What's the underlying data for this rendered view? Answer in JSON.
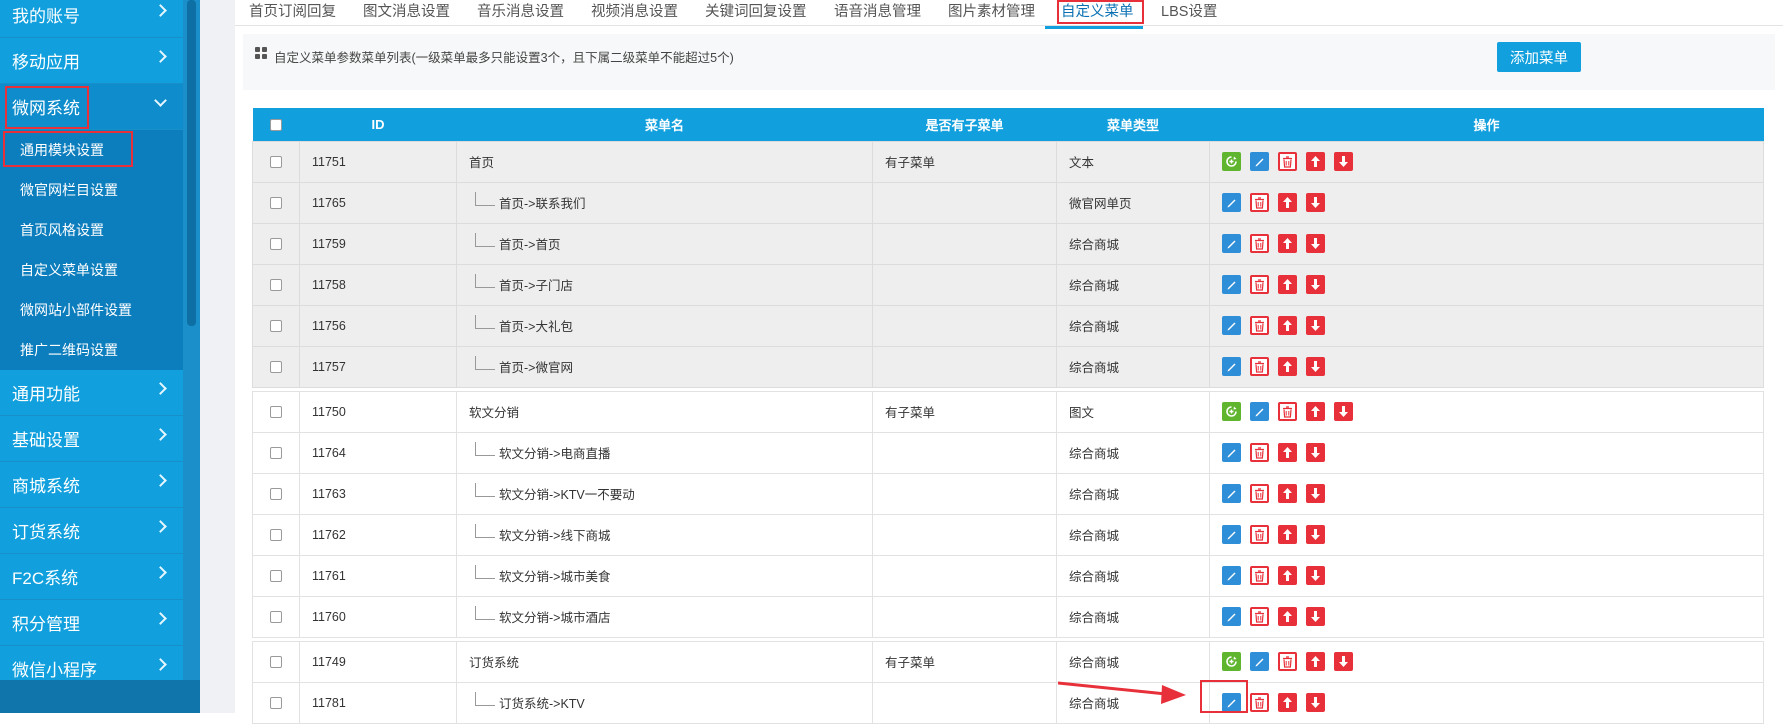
{
  "sidebar": {
    "menu": [
      {
        "label": "我的账号"
      },
      {
        "label": "移动应用"
      },
      {
        "label": "微网系统"
      },
      {
        "label": "通用功能"
      },
      {
        "label": "基础设置"
      },
      {
        "label": "商城系统"
      },
      {
        "label": "订货系统"
      },
      {
        "label": "F2C系统"
      },
      {
        "label": "积分管理"
      },
      {
        "label": "微信小程序"
      }
    ],
    "submenu": [
      {
        "label": "通用模块设置"
      },
      {
        "label": "微官网栏目设置"
      },
      {
        "label": "首页风格设置"
      },
      {
        "label": "自定义菜单设置"
      },
      {
        "label": "微网站小部件设置"
      },
      {
        "label": "推广二维码设置"
      }
    ]
  },
  "tabs": [
    {
      "label": "首页订阅回复"
    },
    {
      "label": "图文消息设置"
    },
    {
      "label": "音乐消息设置"
    },
    {
      "label": "视频消息设置"
    },
    {
      "label": "关键词回复设置"
    },
    {
      "label": "语音消息管理"
    },
    {
      "label": "图片素材管理"
    },
    {
      "label": "自定义菜单"
    },
    {
      "label": "LBS设置"
    }
  ],
  "info_text": "自定义菜单参数菜单列表(一级菜单最多只能设置3个，且下属二级菜单不能超过5个)",
  "add_button": "添加菜单",
  "table": {
    "headers": {
      "id": "ID",
      "name": "菜单名",
      "has_sub": "是否有子菜单",
      "type": "菜单类型",
      "ops": "操作"
    },
    "rows": [
      {
        "id": "11751",
        "name": "首页",
        "has_sub": "有子菜单",
        "type": "文本",
        "level": 1,
        "group": 1
      },
      {
        "id": "11765",
        "name": "首页->联系我们",
        "has_sub": "",
        "type": "微官网单页",
        "level": 2,
        "group": 1
      },
      {
        "id": "11759",
        "name": "首页->首页",
        "has_sub": "",
        "type": "综合商城",
        "level": 2,
        "group": 1
      },
      {
        "id": "11758",
        "name": "首页->子门店",
        "has_sub": "",
        "type": "综合商城",
        "level": 2,
        "group": 1
      },
      {
        "id": "11756",
        "name": "首页->大礼包",
        "has_sub": "",
        "type": "综合商城",
        "level": 2,
        "group": 1
      },
      {
        "id": "11757",
        "name": "首页->微官网",
        "has_sub": "",
        "type": "综合商城",
        "level": 2,
        "group": 1
      },
      {
        "id": "11750",
        "name": "软文分销",
        "has_sub": "有子菜单",
        "type": "图文",
        "level": 1,
        "group": 2
      },
      {
        "id": "11764",
        "name": "软文分销->电商直播",
        "has_sub": "",
        "type": "综合商城",
        "level": 2,
        "group": 2
      },
      {
        "id": "11763",
        "name": "软文分销->KTV一不要动",
        "has_sub": "",
        "type": "综合商城",
        "level": 2,
        "group": 2
      },
      {
        "id": "11762",
        "name": "软文分销->线下商城",
        "has_sub": "",
        "type": "综合商城",
        "level": 2,
        "group": 2
      },
      {
        "id": "11761",
        "name": "软文分销->城市美食",
        "has_sub": "",
        "type": "综合商城",
        "level": 2,
        "group": 2
      },
      {
        "id": "11760",
        "name": "软文分销->城市酒店",
        "has_sub": "",
        "type": "综合商城",
        "level": 2,
        "group": 2
      },
      {
        "id": "11749",
        "name": "订货系统",
        "has_sub": "有子菜单",
        "type": "综合商城",
        "level": 1,
        "group": 3
      },
      {
        "id": "11781",
        "name": "订货系统->KTV",
        "has_sub": "",
        "type": "综合商城",
        "level": 2,
        "group": 3
      }
    ]
  },
  "icons": {
    "add": "add-submenu-icon",
    "edit": "edit-icon",
    "delete": "delete-icon",
    "up": "move-up-icon",
    "down": "move-down-icon"
  },
  "colors": {
    "sidebar": "#11a0dd",
    "accent": "#11a0dd",
    "highlight": "#e8303a",
    "add_icon": "#5fb52e",
    "edit_icon": "#2f8ed8"
  }
}
